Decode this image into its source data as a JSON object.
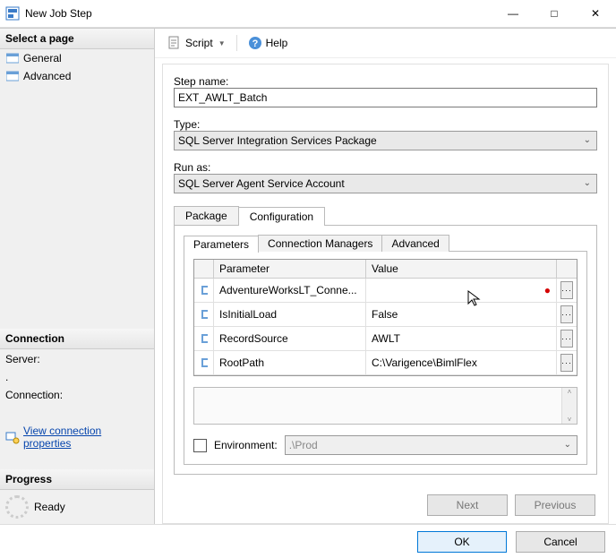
{
  "window": {
    "title": "New Job Step"
  },
  "sidebar": {
    "select_page_label": "Select a page",
    "pages": [
      {
        "label": "General"
      },
      {
        "label": "Advanced"
      }
    ],
    "connection_label": "Connection",
    "server_label": "Server:",
    "server_value": ".",
    "connection_sub_label": "Connection:",
    "connection_value": "",
    "view_conn_link": "View connection properties",
    "progress_label": "Progress",
    "progress_status": "Ready"
  },
  "toolbar": {
    "script_label": "Script",
    "help_label": "Help"
  },
  "form": {
    "step_name_label": "Step name:",
    "step_name_value": "EXT_AWLT_Batch",
    "type_label": "Type:",
    "type_value": "SQL Server Integration Services Package",
    "run_as_label": "Run as:",
    "run_as_value": "SQL Server Agent Service Account"
  },
  "tabs": {
    "outer": [
      {
        "label": "Package",
        "active": false
      },
      {
        "label": "Configuration",
        "active": true
      }
    ],
    "inner": [
      {
        "label": "Parameters",
        "active": true
      },
      {
        "label": "Connection Managers",
        "active": false
      },
      {
        "label": "Advanced",
        "active": false
      }
    ]
  },
  "params": {
    "col_parameter": "Parameter",
    "col_value": "Value",
    "rows": [
      {
        "name": "AdventureWorksLT_Conne...",
        "value": "",
        "error": true
      },
      {
        "name": "IsInitialLoad",
        "value": "False",
        "error": false
      },
      {
        "name": "RecordSource",
        "value": "AWLT",
        "error": false
      },
      {
        "name": "RootPath",
        "value": "C:\\Varigence\\BimlFlex",
        "error": false
      }
    ]
  },
  "env": {
    "label": "Environment:",
    "value": ".\\Prod"
  },
  "nav": {
    "next": "Next",
    "previous": "Previous"
  },
  "footer": {
    "ok": "OK",
    "cancel": "Cancel"
  }
}
